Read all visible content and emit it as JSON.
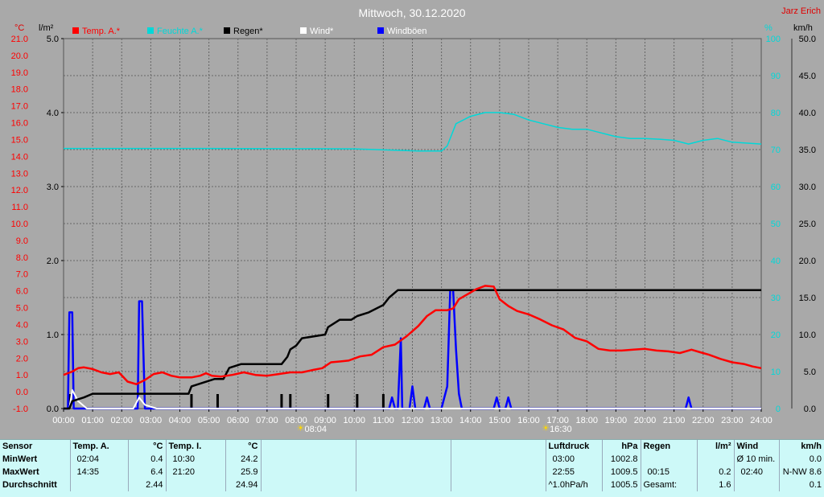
{
  "header": {
    "title": "Mittwoch, 30.12.2020",
    "author": "Jarz Erich"
  },
  "colors": {
    "temperature": "#ff0000",
    "humidity": "#00d8d8",
    "rain": "#000000",
    "wind": "#ffffff",
    "gust": "#0000ff",
    "background": "#a9a9a9",
    "panel": "#cdf9f8"
  },
  "chart_data": {
    "type": "line",
    "title": "Mittwoch, 30.12.2020",
    "legend": [
      "Temp. A.*",
      "Feuchte A.*",
      "Regen*",
      "Wind*",
      "Windböen"
    ],
    "x_ticks": [
      "00:00",
      "01:00",
      "02:00",
      "03:00",
      "04:00",
      "05:00",
      "06:00",
      "07:00",
      "08:00",
      "09:00",
      "10:00",
      "11:00",
      "12:00",
      "13:00",
      "14:00",
      "15:00",
      "16:00",
      "17:00",
      "18:00",
      "19:00",
      "20:00",
      "21:00",
      "22:00",
      "23:00",
      "24:00"
    ],
    "xlim": [
      0,
      24
    ],
    "axes": {
      "temp": {
        "label": "°C",
        "range": [
          -1.0,
          21.0
        ],
        "ticks": [
          "-1.0",
          "0.0",
          "1.0",
          "2.0",
          "3.0",
          "4.0",
          "5.0",
          "6.0",
          "7.0",
          "8.0",
          "9.0",
          "10.0",
          "11.0",
          "12.0",
          "13.0",
          "14.0",
          "15.0",
          "16.0",
          "17.0",
          "18.0",
          "19.0",
          "20.0",
          "21.0"
        ]
      },
      "rain": {
        "label": "l/m²",
        "range": [
          0.0,
          5.0
        ],
        "ticks": [
          "0.0",
          "1.0",
          "2.0",
          "3.0",
          "4.0",
          "5.0"
        ]
      },
      "humidity": {
        "label": "%",
        "range": [
          0,
          100
        ],
        "ticks": [
          "0",
          "10",
          "20",
          "30",
          "40",
          "50",
          "60",
          "70",
          "80",
          "90",
          "100"
        ]
      },
      "wind": {
        "label": "km/h",
        "range": [
          0.0,
          50.0
        ],
        "ticks": [
          "0.0",
          "5.0",
          "10.0",
          "15.0",
          "20.0",
          "25.0",
          "30.0",
          "35.0",
          "40.0",
          "45.0",
          "50.0"
        ]
      }
    },
    "sun": {
      "sunrise": "08:04",
      "sunset": "16:30",
      "sunrise_h": 8.07,
      "sunset_h": 16.5
    },
    "series": [
      {
        "name": "Temp. A.*",
        "axis": "temp",
        "points": [
          [
            0,
            1.0
          ],
          [
            0.3,
            1.2
          ],
          [
            0.5,
            1.4
          ],
          [
            0.7,
            1.45
          ],
          [
            1.0,
            1.35
          ],
          [
            1.3,
            1.15
          ],
          [
            1.6,
            1.05
          ],
          [
            1.9,
            1.15
          ],
          [
            2.04,
            0.9
          ],
          [
            2.2,
            0.6
          ],
          [
            2.5,
            0.45
          ],
          [
            2.8,
            0.7
          ],
          [
            3.1,
            1.05
          ],
          [
            3.4,
            1.15
          ],
          [
            3.7,
            0.95
          ],
          [
            4.0,
            0.85
          ],
          [
            4.4,
            0.85
          ],
          [
            4.7,
            0.95
          ],
          [
            4.9,
            1.1
          ],
          [
            5.1,
            0.95
          ],
          [
            5.4,
            0.9
          ],
          [
            5.8,
            1.0
          ],
          [
            6.2,
            1.15
          ],
          [
            6.6,
            1.0
          ],
          [
            7.0,
            0.95
          ],
          [
            7.4,
            1.05
          ],
          [
            7.8,
            1.15
          ],
          [
            8.2,
            1.15
          ],
          [
            8.6,
            1.3
          ],
          [
            8.9,
            1.4
          ],
          [
            9.2,
            1.75
          ],
          [
            9.5,
            1.8
          ],
          [
            9.8,
            1.85
          ],
          [
            10.2,
            2.1
          ],
          [
            10.6,
            2.2
          ],
          [
            11.0,
            2.65
          ],
          [
            11.4,
            2.8
          ],
          [
            11.8,
            3.3
          ],
          [
            12.2,
            3.9
          ],
          [
            12.5,
            4.5
          ],
          [
            12.8,
            4.85
          ],
          [
            13.2,
            4.85
          ],
          [
            13.4,
            4.95
          ],
          [
            13.6,
            5.5
          ],
          [
            13.9,
            5.8
          ],
          [
            14.2,
            6.1
          ],
          [
            14.5,
            6.3
          ],
          [
            14.8,
            6.25
          ],
          [
            15.0,
            5.5
          ],
          [
            15.3,
            5.1
          ],
          [
            15.6,
            4.8
          ],
          [
            16.0,
            4.6
          ],
          [
            16.4,
            4.3
          ],
          [
            16.8,
            3.95
          ],
          [
            17.2,
            3.7
          ],
          [
            17.6,
            3.2
          ],
          [
            18.0,
            3.0
          ],
          [
            18.4,
            2.55
          ],
          [
            18.8,
            2.45
          ],
          [
            19.2,
            2.45
          ],
          [
            19.6,
            2.5
          ],
          [
            20.0,
            2.55
          ],
          [
            20.4,
            2.45
          ],
          [
            20.8,
            2.4
          ],
          [
            21.2,
            2.3
          ],
          [
            21.6,
            2.5
          ],
          [
            21.9,
            2.35
          ],
          [
            22.2,
            2.2
          ],
          [
            22.6,
            1.95
          ],
          [
            23.0,
            1.75
          ],
          [
            23.4,
            1.65
          ],
          [
            23.7,
            1.5
          ],
          [
            24.0,
            1.4
          ]
        ]
      },
      {
        "name": "Feuchte A.*",
        "axis": "humidity",
        "points": [
          [
            0,
            70.3
          ],
          [
            5,
            70.3
          ],
          [
            10,
            70.2
          ],
          [
            12.2,
            69.6
          ],
          [
            13.0,
            69.6
          ],
          [
            13.2,
            71
          ],
          [
            13.5,
            77
          ],
          [
            14.0,
            79
          ],
          [
            14.5,
            80
          ],
          [
            15.0,
            80
          ],
          [
            15.5,
            79.5
          ],
          [
            16.0,
            78
          ],
          [
            16.5,
            77
          ],
          [
            17.0,
            76
          ],
          [
            17.5,
            75.5
          ],
          [
            18.0,
            75.5
          ],
          [
            18.5,
            74.5
          ],
          [
            19.0,
            73.5
          ],
          [
            19.5,
            73
          ],
          [
            20.0,
            73
          ],
          [
            20.5,
            72.8
          ],
          [
            21.0,
            72.5
          ],
          [
            21.5,
            71.5
          ],
          [
            22.0,
            72.5
          ],
          [
            22.5,
            73
          ],
          [
            23.0,
            72
          ],
          [
            24.0,
            71.5
          ]
        ]
      },
      {
        "name": "Regen*",
        "axis": "rain",
        "points": [
          [
            0,
            0.0
          ],
          [
            0.2,
            0.0
          ],
          [
            0.3,
            0.1
          ],
          [
            0.7,
            0.15
          ],
          [
            1.0,
            0.2
          ],
          [
            4.3,
            0.2
          ],
          [
            4.4,
            0.3
          ],
          [
            4.8,
            0.35
          ],
          [
            5.2,
            0.4
          ],
          [
            5.5,
            0.4
          ],
          [
            5.7,
            0.55
          ],
          [
            6.1,
            0.6
          ],
          [
            7.5,
            0.6
          ],
          [
            7.7,
            0.7
          ],
          [
            7.8,
            0.8
          ],
          [
            8.0,
            0.85
          ],
          [
            8.2,
            0.95
          ],
          [
            9.0,
            1.0
          ],
          [
            9.1,
            1.1
          ],
          [
            9.5,
            1.2
          ],
          [
            9.9,
            1.2
          ],
          [
            10.1,
            1.25
          ],
          [
            10.5,
            1.3
          ],
          [
            11.0,
            1.4
          ],
          [
            11.2,
            1.5
          ],
          [
            11.5,
            1.6
          ],
          [
            12.0,
            1.6
          ],
          [
            24.0,
            1.6
          ]
        ]
      },
      {
        "name": "Windböen",
        "axis": "wind",
        "points": [
          [
            0,
            0
          ],
          [
            0.15,
            0
          ],
          [
            0.2,
            13
          ],
          [
            0.3,
            13
          ],
          [
            0.35,
            0
          ],
          [
            2.55,
            0
          ],
          [
            2.6,
            14.5
          ],
          [
            2.7,
            14.5
          ],
          [
            2.8,
            0
          ],
          [
            11.2,
            0
          ],
          [
            11.3,
            1.5
          ],
          [
            11.4,
            0
          ],
          [
            11.5,
            0
          ],
          [
            11.6,
            9.5
          ],
          [
            11.65,
            0
          ],
          [
            11.9,
            0
          ],
          [
            12.0,
            3.0
          ],
          [
            12.1,
            0
          ],
          [
            12.4,
            0
          ],
          [
            12.5,
            1.5
          ],
          [
            12.6,
            0
          ],
          [
            13.0,
            0
          ],
          [
            13.1,
            1.5
          ],
          [
            13.2,
            3.0
          ],
          [
            13.3,
            16.0
          ],
          [
            13.4,
            16.0
          ],
          [
            13.5,
            8.0
          ],
          [
            13.6,
            2.0
          ],
          [
            13.7,
            0
          ],
          [
            14.8,
            0
          ],
          [
            14.9,
            1.5
          ],
          [
            15.0,
            0
          ],
          [
            15.2,
            0
          ],
          [
            15.3,
            1.5
          ],
          [
            15.4,
            0
          ],
          [
            21.4,
            0
          ],
          [
            21.5,
            1.5
          ],
          [
            21.6,
            0
          ],
          [
            24,
            0
          ]
        ]
      },
      {
        "name": "Wind*",
        "axis": "wind",
        "points": [
          [
            0,
            0
          ],
          [
            0.2,
            0
          ],
          [
            0.3,
            2.5
          ],
          [
            0.5,
            1.0
          ],
          [
            0.8,
            0
          ],
          [
            2.4,
            0
          ],
          [
            2.6,
            1.5
          ],
          [
            2.8,
            0.5
          ],
          [
            3.2,
            0
          ],
          [
            24,
            0
          ]
        ]
      }
    ],
    "rain_bars": {
      "axis": "rain",
      "x": [
        0.2,
        4.4,
        5.3,
        7.5,
        7.8,
        9.1,
        10.1,
        11.0
      ]
    }
  },
  "stats": {
    "sensor": {
      "header": "Sensor",
      "rows": [
        "MinWert",
        "MaxWert",
        "Durchschnitt"
      ]
    },
    "temp_a": {
      "header": "Temp. A.",
      "unit": "°C",
      "min_time": "02:04",
      "min": "0.4",
      "max_time": "14:35",
      "max": "6.4",
      "avg": "2.44"
    },
    "temp_i": {
      "header": "Temp. I.",
      "unit": "°C",
      "min_time": "10:30",
      "min": "24.2",
      "max_time": "21:20",
      "max": "25.9",
      "avg": "24.94"
    },
    "pressure": {
      "header": "Luftdruck",
      "unit": "hPa",
      "min_time": "03:00",
      "min": "1002.8",
      "max_time": "22:55",
      "max": "1009.5",
      "trend": "^1.0hPa/h",
      "avg": "1005.5"
    },
    "rain": {
      "header": "Regen",
      "unit": "l/m²",
      "max_time": "00:15",
      "max": "0.2",
      "total_label": "Gesamt:",
      "total": "1.6"
    },
    "wind": {
      "header": "Wind",
      "unit": "km/h",
      "r1_label": "Ø 10 min.",
      "r1_value": "0.0",
      "r2_time": "02:40",
      "r2_value": "N-NW 8.6",
      "r3_value": "0.1"
    }
  }
}
